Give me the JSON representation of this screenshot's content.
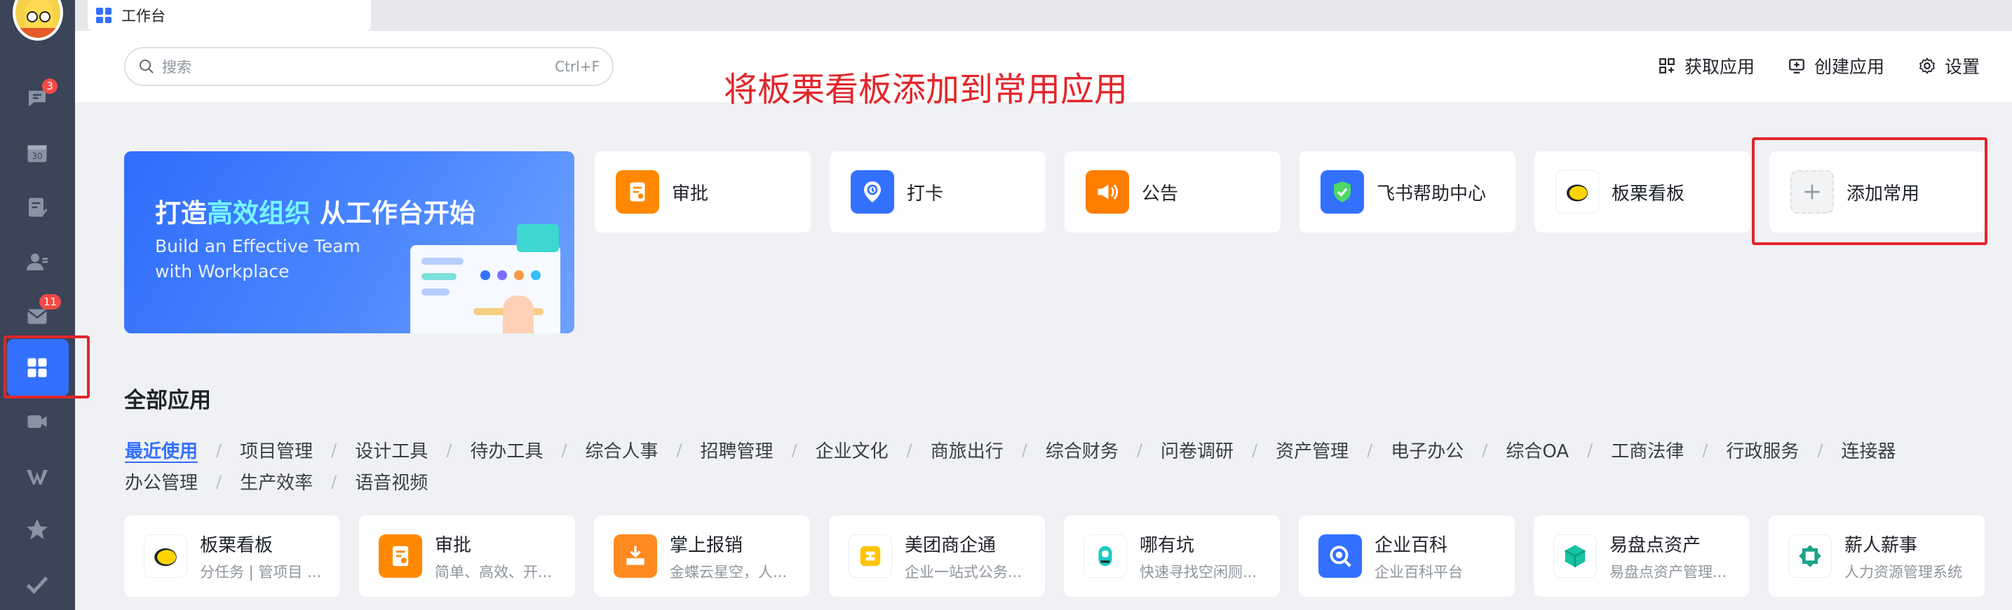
{
  "tab": {
    "label": "工作台"
  },
  "rail": {
    "items": [
      {
        "name": "messages-icon",
        "badge": "3"
      },
      {
        "name": "calendar-icon",
        "day": "30"
      },
      {
        "name": "approval-icon"
      },
      {
        "name": "contacts-icon"
      },
      {
        "name": "mail-icon",
        "badge": "11"
      },
      {
        "name": "workplace-icon"
      },
      {
        "name": "video-meeting-icon"
      },
      {
        "name": "docs-icon"
      },
      {
        "name": "favorites-icon"
      },
      {
        "name": "tasks-icon"
      }
    ]
  },
  "header": {
    "search_placeholder": "搜索",
    "search_hotkey": "Ctrl+F",
    "annotation": "将板栗看板添加到常用应用",
    "get_apps": "获取应用",
    "create_app": "创建应用",
    "settings": "设置"
  },
  "banner": {
    "title_prefix": "打造",
    "title_highlight": "高效组织",
    "title_suffix": "从工作台开始",
    "subtitle_line1": "Build an Effective Team",
    "subtitle_line2": "with Workplace"
  },
  "favorites": [
    {
      "label": "审批",
      "icon": "approval-icon",
      "color": "#ff8800"
    },
    {
      "label": "打卡",
      "icon": "clock-in-icon",
      "color": "#3370ff"
    },
    {
      "label": "公告",
      "icon": "announcement-icon",
      "color": "#ff7d00"
    },
    {
      "label": "飞书帮助中心",
      "icon": "help-center-icon",
      "color": "#3370ff"
    },
    {
      "label": "板栗看板",
      "icon": "banli-board-icon",
      "color": "#ffd400"
    },
    {
      "label": "添加常用",
      "icon": "plus-icon",
      "color": "#8f959e"
    }
  ],
  "all_apps": {
    "title": "全部应用",
    "categories_row1": [
      "最近使用",
      "项目管理",
      "设计工具",
      "待办工具",
      "综合人事",
      "招聘管理",
      "企业文化",
      "商旅出行",
      "综合财务",
      "问卷调研",
      "资产管理",
      "电子办公",
      "综合OA",
      "工商法律",
      "行政服务",
      "连接器"
    ],
    "categories_row2": [
      "办公管理",
      "生产效率",
      "语音视频"
    ],
    "apps": [
      {
        "name": "板栗看板",
        "desc": "分任务 | 管项目 ...",
        "icon": "banli-board-icon",
        "color": "#ffd400"
      },
      {
        "name": "审批",
        "desc": "简单、高效、开...",
        "icon": "approval-icon",
        "color": "#ff8800"
      },
      {
        "name": "掌上报销",
        "desc": "金蝶云星空，人...",
        "icon": "reimbursement-icon",
        "color": "#ff8a1f"
      },
      {
        "name": "美团商企通",
        "desc": "企业一站式公务...",
        "icon": "meituan-icon",
        "color": "#ffc300"
      },
      {
        "name": "哪有坑",
        "desc": "快速寻找空闲厕...",
        "icon": "toilet-finder-icon",
        "color": "#1dc9c3"
      },
      {
        "name": "企业百科",
        "desc": "企业百科平台",
        "icon": "encyclopedia-icon",
        "color": "#3370ff"
      },
      {
        "name": "易盘点资产",
        "desc": "易盘点资产管理...",
        "icon": "asset-icon",
        "color": "#14c4a5"
      },
      {
        "name": "薪人薪事",
        "desc": "人力资源管理系统",
        "icon": "hr-icon",
        "color": "#1aa587"
      }
    ]
  }
}
